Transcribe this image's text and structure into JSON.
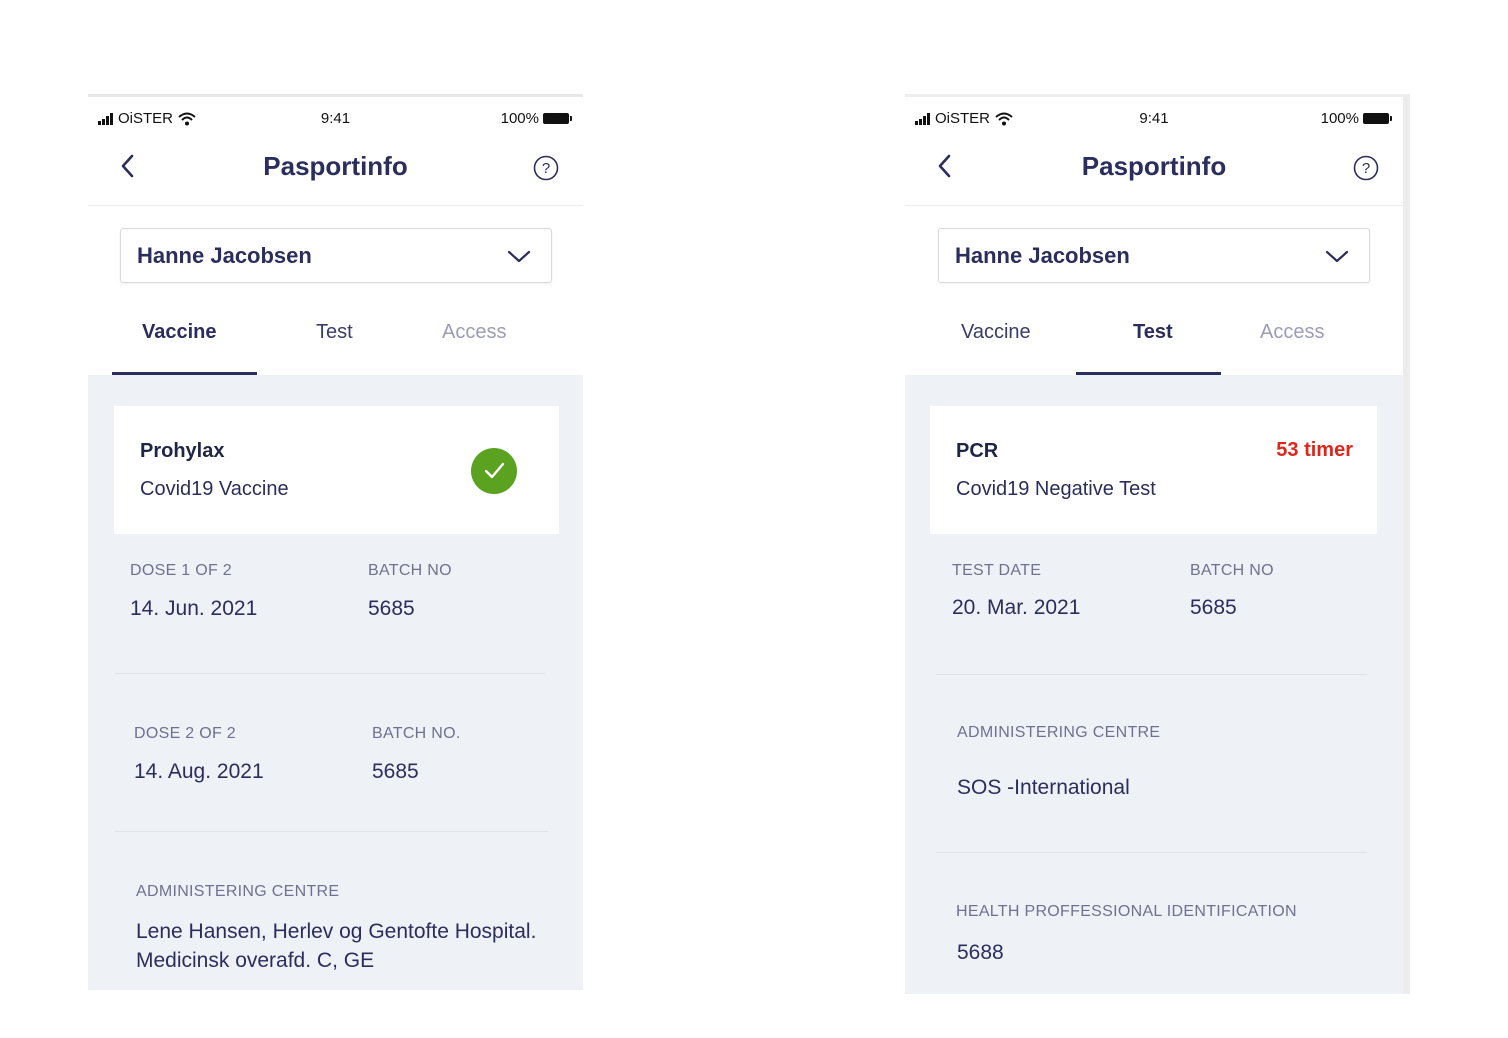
{
  "screens": [
    {
      "status": {
        "carrier": "OiSTER",
        "time": "9:41",
        "battery": "100%"
      },
      "header": {
        "title": "Pasportinfo"
      },
      "person": "Hanne Jacobsen",
      "tabs": [
        {
          "label": "Vaccine"
        },
        {
          "label": "Test"
        },
        {
          "label": "Access"
        }
      ],
      "card": {
        "title": "Prohylax",
        "subtitle": "Covid19 Vaccine"
      },
      "dose1": {
        "label": "DOSE 1 OF 2",
        "date": "14. Jun. 2021",
        "batch_label": "BATCH NO",
        "batch": "5685"
      },
      "dose2": {
        "label": "DOSE 2 OF 2",
        "date": "14. Aug. 2021",
        "batch_label": "BATCH NO.",
        "batch": "5685"
      },
      "centre": {
        "label": "ADMINISTERING CENTRE",
        "line1": "Lene Hansen, Herlev og Gentofte Hospital.",
        "line2": "Medicinsk overafd. C, GE"
      }
    },
    {
      "status": {
        "carrier": "OiSTER",
        "time": "9:41",
        "battery": "100%"
      },
      "header": {
        "title": "Pasportinfo"
      },
      "person": "Hanne Jacobsen",
      "tabs": [
        {
          "label": "Vaccine"
        },
        {
          "label": "Test"
        },
        {
          "label": "Access"
        }
      ],
      "card": {
        "title": "PCR",
        "subtitle": "Covid19 Negative Test",
        "timer": "53 timer"
      },
      "test": {
        "date_label": "TEST DATE",
        "date": "20. Mar. 2021",
        "batch_label": "BATCH NO",
        "batch": "5685"
      },
      "centre": {
        "label": "ADMINISTERING CENTRE",
        "value": "SOS -International"
      },
      "hp": {
        "label": "HEALTH PROFFESSIONAL IDENTIFICATION",
        "value": "5688"
      }
    }
  ],
  "colors": {
    "accent": "#2b2d5c",
    "check_green": "#5aa21f",
    "timer_red": "#e0251b",
    "panel_bg": "#eef2f7"
  },
  "icons": [
    "signal-icon",
    "wifi-icon",
    "battery-icon",
    "back-chevron-icon",
    "help-icon",
    "chevron-down-icon",
    "checkmark-icon"
  ]
}
